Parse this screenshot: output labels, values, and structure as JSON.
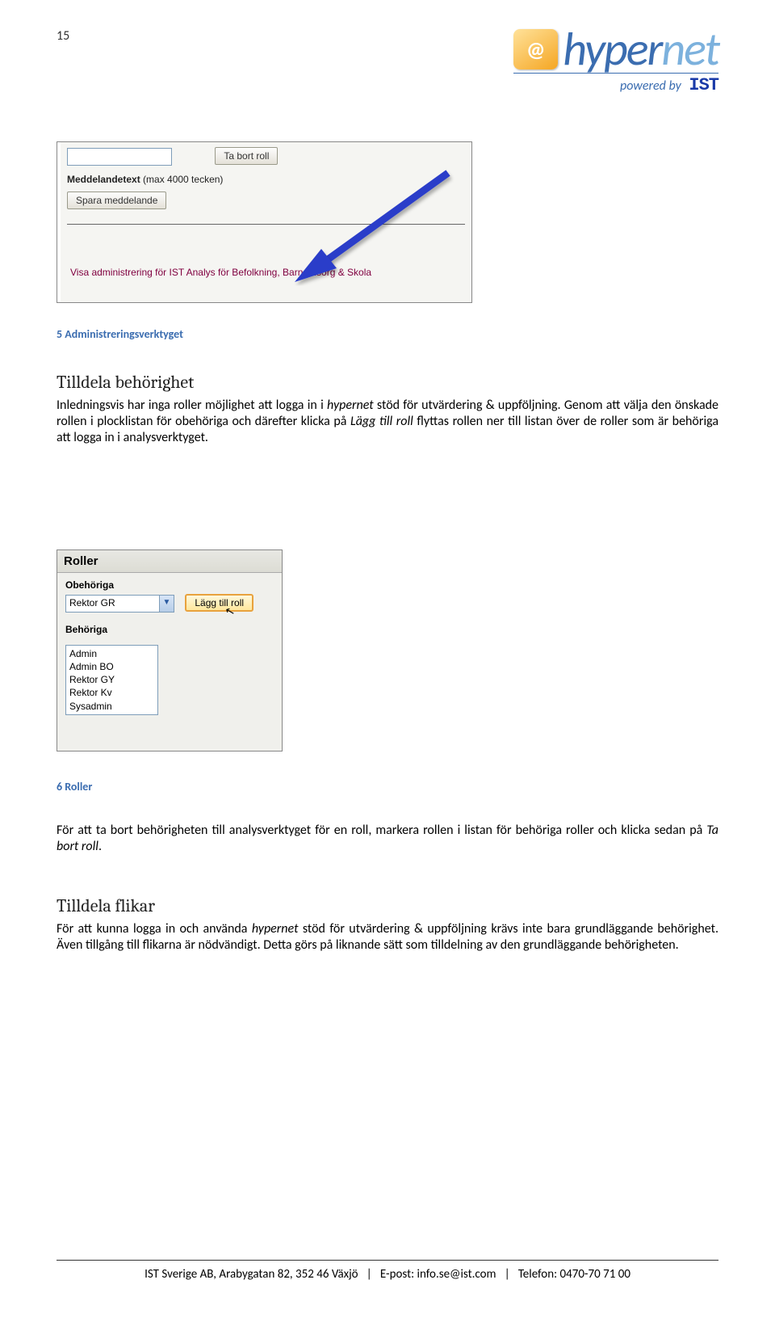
{
  "page": {
    "number": "15"
  },
  "logo": {
    "badge": "@",
    "main": "hyper",
    "suffix": "net",
    "powered": "powered by",
    "ist": "IST"
  },
  "shot1": {
    "remove_btn": "Ta bort roll",
    "meta_label": "Meddelandetext",
    "meta_sub": "(max 4000 tecken)",
    "save_btn": "Spara meddelande",
    "visa_link": "Visa administrering för IST Analys för Befolkning, Barnomsorg & Skola"
  },
  "caption5": "5 Administreringsverktyget",
  "section1": {
    "title": "Tilldela behörighet",
    "p": "Inledningsvis har inga roller möjlighet att logga in i ",
    "em1": "hypernet",
    "p_cont": " stöd för utvärdering & uppföljning. Genom att välja den önskade rollen i plocklistan för obehöriga och därefter klicka på ",
    "em2": "Lägg till roll",
    "p_end": " flyttas rollen ner till listan över de roller som är behöriga att logga in i analysverktyget."
  },
  "shot2": {
    "header": "Roller",
    "obehoriga": "Obehöriga",
    "select_value": "Rektor GR",
    "add_btn": "Lägg till roll",
    "behoriga": "Behöriga",
    "list": [
      "Admin",
      "Admin BO",
      "Rektor GY",
      "Rektor Kv",
      "Sysadmin"
    ]
  },
  "caption6": "6 Roller",
  "section2": {
    "p": "För att ta bort behörigheten till analysverktyget för en roll, markera rollen i listan för behöriga roller och klicka sedan på ",
    "em": "Ta bort roll",
    "end": "."
  },
  "section3": {
    "title": "Tilldela flikar",
    "p": "För att kunna logga in och använda ",
    "em": "hypernet",
    "p2": " stöd för utvärdering & uppföljning krävs inte bara grundläggande behörighet. Även tillgång till flikarna är nödvändigt. Detta görs på liknande sätt som tilldelning av den grundläggande behörigheten."
  },
  "footer": {
    "company": "IST Sverige AB, Arabygatan 82, 352 46 Växjö",
    "sep": "|",
    "email_label": "E-post:",
    "email": "info.se@ist.com",
    "phone_label": "Telefon:",
    "phone": "0470-70 71 00"
  }
}
